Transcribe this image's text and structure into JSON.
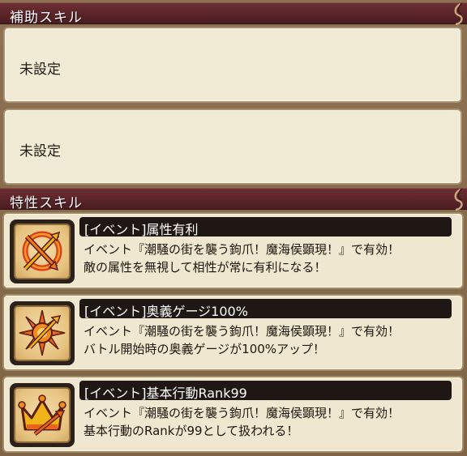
{
  "support_skills": {
    "header": "補助スキル",
    "slots": [
      {
        "label": "未設定"
      },
      {
        "label": "未設定"
      }
    ]
  },
  "trait_skills": {
    "header": "特性スキル",
    "items": [
      {
        "name": "[イベント]属性有利",
        "icon": "crossed-arrows-target-icon",
        "desc_line1": "イベント『潮騒の街を襲う鉤爪！魔海侯顕現！』で有効！",
        "desc_line2": "敵の属性を無視して相性が常に有利になる！"
      },
      {
        "name": "[イベント]奥義ゲージ100%",
        "icon": "burst-wheel-arrow-icon",
        "desc_line1": "イベント『潮騒の街を襲う鉤爪！魔海侯顕現！』で有効！",
        "desc_line2": "バトル開始時の奥義ゲージが100%アップ！"
      },
      {
        "name": "[イベント]基本行動Rank99",
        "icon": "crown-arrow-icon",
        "desc_line1": "イベント『潮騒の街を襲う鉤爪！魔海侯顕現！』で有効！",
        "desc_line2": "基本行動のRankが99として扱われる！"
      }
    ]
  },
  "colors": {
    "header_bg": "#5a2428",
    "panel_bg": "#f1ebd6",
    "name_bar_bg": "#1f1713",
    "icon_orange": "#e8641c",
    "icon_gold": "#f2b318"
  }
}
